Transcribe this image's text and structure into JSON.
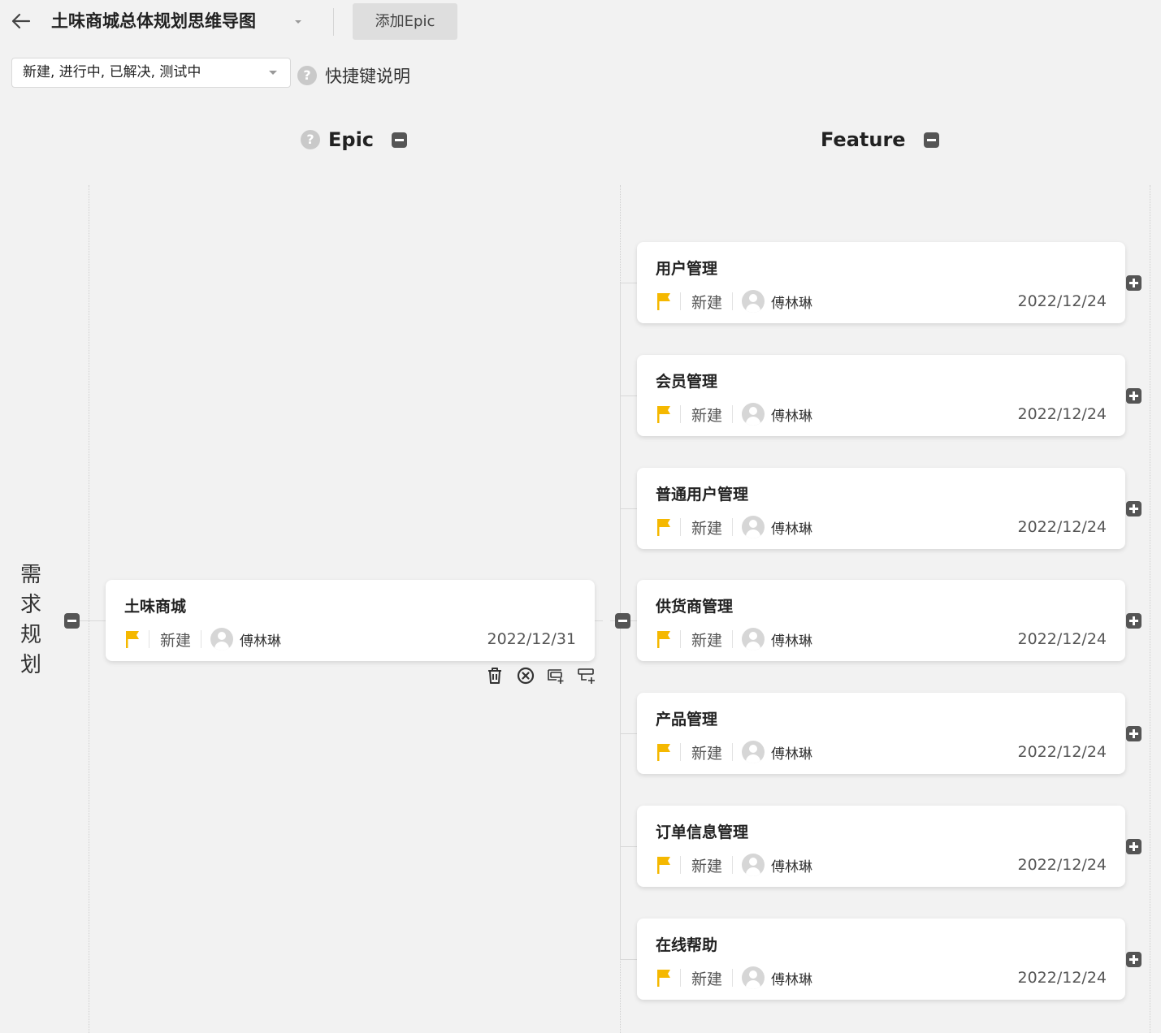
{
  "header": {
    "title": "土味商城总体规划思维导图",
    "add_epic_label": "添加Epic"
  },
  "filter": {
    "status_value": "新建, 进行中, 已解决, 测试中",
    "shortcut_help_label": "快捷键说明"
  },
  "columns": {
    "epic_label": "Epic",
    "feature_label": "Feature",
    "help_glyph": "?"
  },
  "root": {
    "label": "需求规划",
    "chars": [
      "需",
      "求",
      "规",
      "划"
    ]
  },
  "epic": {
    "title": "土味商城",
    "status": "新建",
    "owner": "傅林琳",
    "date": "2022/12/31"
  },
  "features": [
    {
      "title": "用户管理",
      "status": "新建",
      "owner": "傅林琳",
      "date": "2022/12/24"
    },
    {
      "title": "会员管理",
      "status": "新建",
      "owner": "傅林琳",
      "date": "2022/12/24"
    },
    {
      "title": "普通用户管理",
      "status": "新建",
      "owner": "傅林琳",
      "date": "2022/12/24"
    },
    {
      "title": "供货商管理",
      "status": "新建",
      "owner": "傅林琳",
      "date": "2022/12/24"
    },
    {
      "title": "产品管理",
      "status": "新建",
      "owner": "傅林琳",
      "date": "2022/12/24"
    },
    {
      "title": "订单信息管理",
      "status": "新建",
      "owner": "傅林琳",
      "date": "2022/12/24"
    },
    {
      "title": "在线帮助",
      "status": "新建",
      "owner": "傅林琳",
      "date": "2022/12/24"
    }
  ],
  "epic_actions": [
    "delete-icon",
    "close-circle-icon",
    "add-sibling-icon",
    "add-child-icon"
  ],
  "colors": {
    "flag": "#f5b800",
    "background": "#f2f2f2",
    "button_dark": "#555555"
  }
}
